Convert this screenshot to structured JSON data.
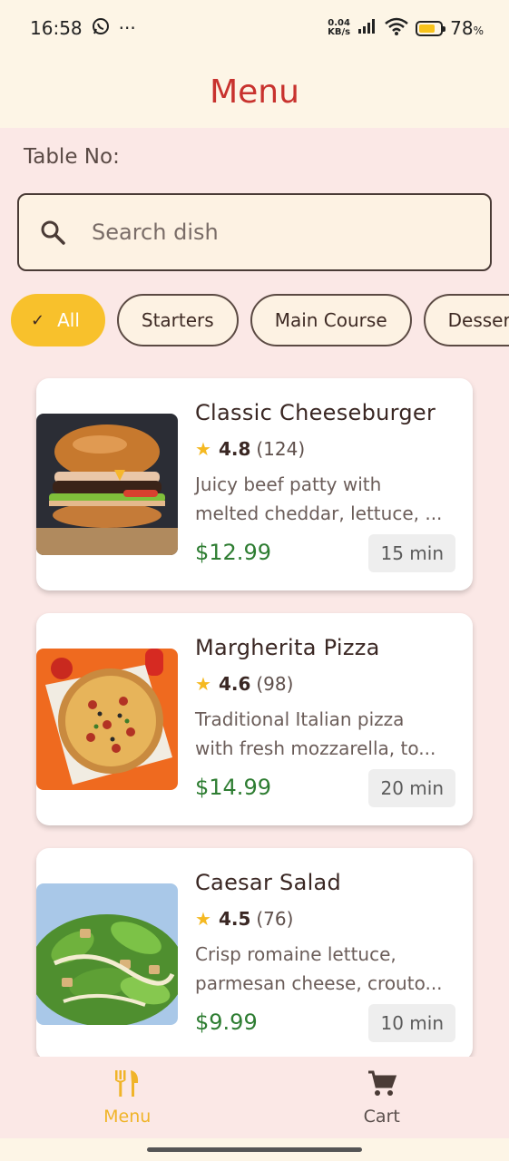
{
  "status_bar": {
    "time": "16:58",
    "more": "···",
    "netspeed_value": "0.04",
    "netspeed_unit": "KB/s",
    "battery_percent": "78",
    "battery_percent_sign": "%",
    "battery_level": 0.78,
    "battery_color": "#f7c21b"
  },
  "app_bar": {
    "title": "Menu",
    "title_color": "#c8322e"
  },
  "table_label": "Table No:",
  "search": {
    "placeholder": "Search dish",
    "value": ""
  },
  "categories": [
    {
      "label": "All",
      "selected": true
    },
    {
      "label": "Starters",
      "selected": false
    },
    {
      "label": "Main Course",
      "selected": false
    },
    {
      "label": "Desserts",
      "selected": false
    }
  ],
  "dishes": [
    {
      "name": "Classic Cheeseburger",
      "rating": "4.8",
      "reviews": "(124)",
      "description_line1": "Juicy beef patty with",
      "description_line2": "melted cheddar, lettuce, ...",
      "price": "$12.99",
      "time": "15 min",
      "image": "cheeseburger"
    },
    {
      "name": "Margherita Pizza",
      "rating": "4.6",
      "reviews": "(98)",
      "description_line1": "Traditional Italian pizza",
      "description_line2": "with fresh mozzarella, to...",
      "price": "$14.99",
      "time": "20 min",
      "image": "pizza"
    },
    {
      "name": "Caesar Salad",
      "rating": "4.5",
      "reviews": "(76)",
      "description_line1": "Crisp romaine lettuce,",
      "description_line2": "parmesan cheese, crouto...",
      "price": "$9.99",
      "time": "10 min",
      "image": "salad"
    }
  ],
  "bottom_nav": [
    {
      "label": "Menu",
      "icon": "fork-knife-icon",
      "active": true
    },
    {
      "label": "Cart",
      "icon": "cart-icon",
      "active": false
    }
  ],
  "colors": {
    "accent": "#f8c12c",
    "price": "#2e7d32",
    "background": "#fbe8e6",
    "header": "#fdf5e6"
  }
}
